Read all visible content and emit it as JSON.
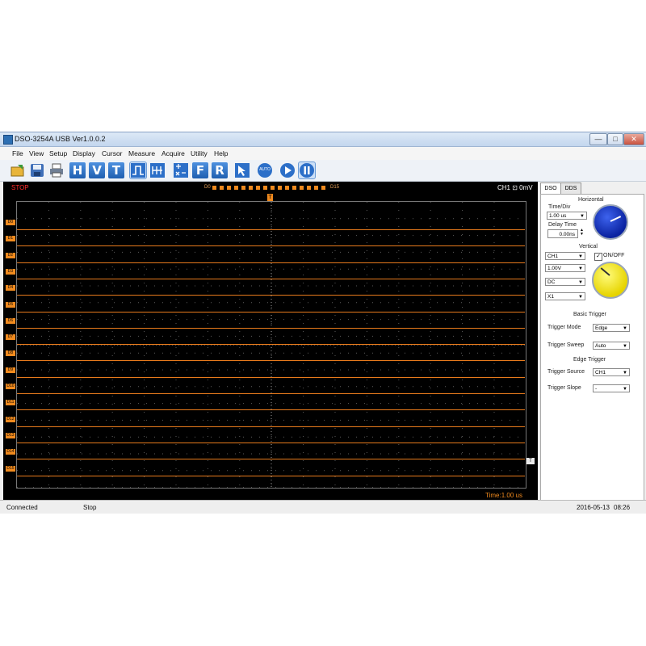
{
  "window": {
    "title": "DSO-3254A USB Ver1.0.0.2",
    "controls": [
      "—",
      "□",
      "✕"
    ]
  },
  "menu": [
    "File",
    "View",
    "Setup",
    "Display",
    "Cursor",
    "Measure",
    "Acquire",
    "Utility",
    "Help"
  ],
  "toolbar": {
    "h_label": "H",
    "v_label": "V",
    "t_label": "T",
    "f_label": "F",
    "r_label": "R",
    "auto_label": "AUTO"
  },
  "scope": {
    "run_state": "STOP",
    "bus_start": "D0",
    "bus_end": "D15",
    "trigger_marker": "T",
    "channel_readout": "CH1 ⊡ 0mV",
    "time_readout": "Time:1.00 us",
    "channel_labels": [
      "D0",
      "D1",
      "D2",
      "D3",
      "D4",
      "D5",
      "D6",
      "D7",
      "D8",
      "D9",
      "D10",
      "D11",
      "D12",
      "D13",
      "D14",
      "D15"
    ],
    "right_trigger_marker": "T"
  },
  "panel": {
    "tabs": [
      "DSO",
      "DDS"
    ],
    "horizontal_title": "Horizontal",
    "time_div_label": "Time/Div",
    "time_div_value": "1.00 us",
    "delay_label": "Delay Time",
    "delay_value": "0.00ns",
    "vertical_title": "Vertical",
    "channel_value": "CH1",
    "onoff_label": "ON/OFF",
    "volts_value": "1.00V",
    "coupling_value": "DC",
    "probe_value": "X1",
    "basic_trigger_title": "Basic Trigger",
    "trigger_mode_label": "Trigger Mode",
    "trigger_mode_value": "Edge",
    "trigger_sweep_label": "Trigger Sweep",
    "trigger_sweep_value": "Auto",
    "edge_trigger_title": "Edge Trigger",
    "trigger_source_label": "Trigger Source",
    "trigger_source_value": "CH1",
    "trigger_slope_label": "Trigger Slope",
    "trigger_slope_value": "-",
    "knob_colors": {
      "horizontal": "#1335c8",
      "vertical": "#f3e40b"
    }
  },
  "status": {
    "connection": "Connected",
    "state": "Stop",
    "date": "2016-05-13",
    "time": "08:26"
  }
}
